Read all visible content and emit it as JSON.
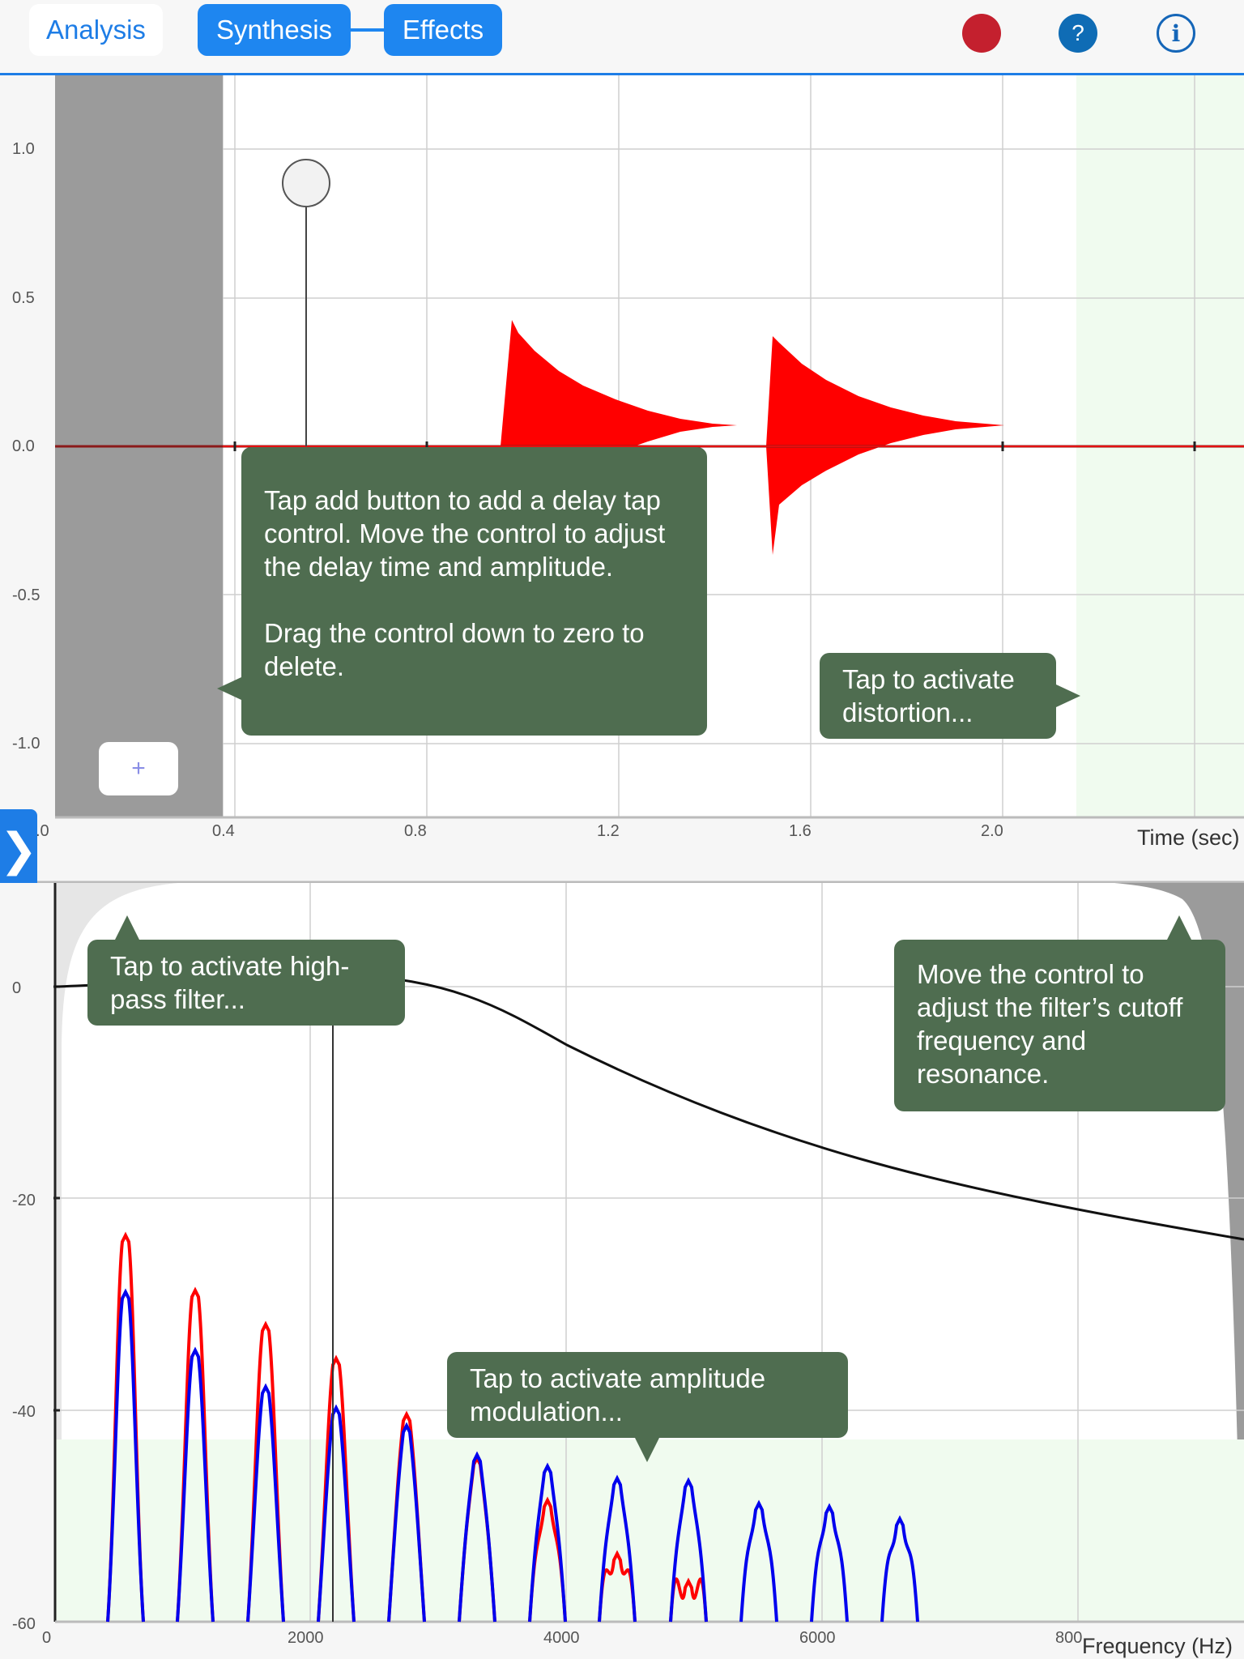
{
  "header": {
    "tabs": [
      {
        "label": "Analysis"
      },
      {
        "label": "Synthesis"
      },
      {
        "label": "Effects"
      }
    ],
    "help_label": "?",
    "info_label": "i",
    "record_color": "#c4202e",
    "accent_color": "#1e7de6"
  },
  "time_plot": {
    "y_ticks": [
      "1.0",
      "0.5",
      "0.0",
      "-0.5",
      "-1.0"
    ],
    "x_ticks": [
      ".0",
      "0.4",
      "0.8",
      "1.2",
      "1.6",
      "2.0"
    ],
    "x_label": "Time (sec)",
    "waveform_color": "#ff0000",
    "delay_tap": {
      "time": 0.55,
      "amplitude": 0.88
    },
    "add_button_label": "+",
    "tips": {
      "delay": "Tap add button to add a delay tap control. Move the control to adjust the delay time and amplitude.\n\nDrag the control down to zero to delete.",
      "distortion": "Tap to activate distortion..."
    }
  },
  "freq_plot": {
    "y_ticks": [
      "0",
      "-20",
      "-40",
      "-60"
    ],
    "x_ticks": [
      "0",
      "2000",
      "4000",
      "6000",
      "800"
    ],
    "x_label": "Frequency (Hz)",
    "series_colors": {
      "red": "#ff0000",
      "blue": "#0000ee",
      "filter": "#000000"
    },
    "filter_control": {
      "frequency": 2200,
      "level": 0
    },
    "tips": {
      "highpass": "Tap to activate high-pass filter...",
      "cutoff": "Move the control to adjust the filter’s cutoff frequency and resonance.",
      "am": "Tap to activate amplitude modulation..."
    }
  },
  "side_toggle_label": "❯"
}
